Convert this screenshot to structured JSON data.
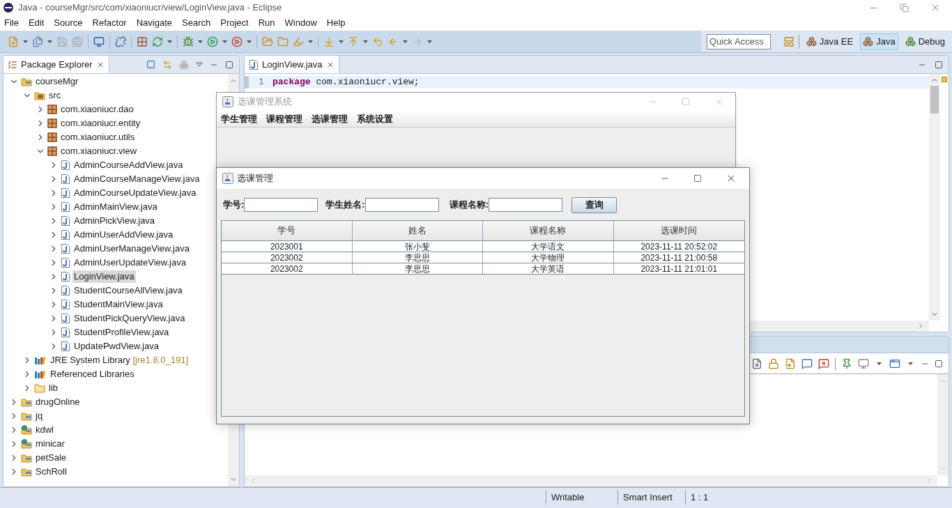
{
  "window": {
    "title": "Java - courseMgr/src/com/xiaoniucr/view/LoginView.java - Eclipse"
  },
  "menu": [
    "File",
    "Edit",
    "Source",
    "Refactor",
    "Navigate",
    "Search",
    "Project",
    "Run",
    "Window",
    "Help"
  ],
  "quick_access": {
    "placeholder": "Quick Access"
  },
  "perspectives": [
    {
      "label": "Java EE",
      "selected": false
    },
    {
      "label": "Java",
      "selected": true
    },
    {
      "label": "Debug",
      "selected": false
    }
  ],
  "package_explorer": {
    "title": "Package Explorer",
    "tree": [
      {
        "label": "courseMgr",
        "kind": "project",
        "expanded": true,
        "selected": false,
        "children": [
          {
            "label": "src",
            "kind": "source-folder",
            "expanded": true,
            "selected": false,
            "children": [
              {
                "label": "com.xiaoniucr.dao",
                "kind": "package",
                "expanded": false,
                "selected": false
              },
              {
                "label": "com.xiaoniucr.entity",
                "kind": "package",
                "expanded": false,
                "selected": false
              },
              {
                "label": "com.xiaoniucr.utils",
                "kind": "package",
                "expanded": false,
                "selected": false
              },
              {
                "label": "com.xiaoniucr.view",
                "kind": "package",
                "expanded": true,
                "selected": false,
                "children": [
                  {
                    "label": "AdminCourseAddView.java",
                    "kind": "java-file",
                    "expanded": false,
                    "selected": false
                  },
                  {
                    "label": "AdminCourseManageView.java",
                    "kind": "java-file",
                    "expanded": false,
                    "selected": false
                  },
                  {
                    "label": "AdminCourseUpdateView.java",
                    "kind": "java-file",
                    "expanded": false,
                    "selected": false
                  },
                  {
                    "label": "AdminMainView.java",
                    "kind": "java-file",
                    "expanded": false,
                    "selected": false
                  },
                  {
                    "label": "AdminPickView.java",
                    "kind": "java-file",
                    "expanded": false,
                    "selected": false
                  },
                  {
                    "label": "AdminUserAddView.java",
                    "kind": "java-file",
                    "expanded": false,
                    "selected": false
                  },
                  {
                    "label": "AdminUserManageView.java",
                    "kind": "java-file",
                    "expanded": false,
                    "selected": false
                  },
                  {
                    "label": "AdminUserUpdateView.java",
                    "kind": "java-file",
                    "expanded": false,
                    "selected": false
                  },
                  {
                    "label": "LoginView.java",
                    "kind": "java-file",
                    "expanded": false,
                    "selected": true
                  },
                  {
                    "label": "StudentCourseAllView.java",
                    "kind": "java-file",
                    "expanded": false,
                    "selected": false
                  },
                  {
                    "label": "StudentMainView.java",
                    "kind": "java-file",
                    "expanded": false,
                    "selected": false
                  },
                  {
                    "label": "StudentPickQueryView.java",
                    "kind": "java-file",
                    "expanded": false,
                    "selected": false
                  },
                  {
                    "label": "StudentProfileView.java",
                    "kind": "java-file",
                    "expanded": false,
                    "selected": false
                  },
                  {
                    "label": "UpdatePwdView.java",
                    "kind": "java-file",
                    "expanded": false,
                    "selected": false
                  }
                ]
              }
            ]
          },
          {
            "label": "JRE System Library",
            "suffix": "[jre1.8.0_191]",
            "kind": "library",
            "expanded": false,
            "selected": false
          },
          {
            "label": "Referenced Libraries",
            "kind": "library",
            "expanded": false,
            "selected": false
          },
          {
            "label": "lib",
            "kind": "folder",
            "expanded": false,
            "selected": false
          }
        ]
      },
      {
        "label": "drugOnline",
        "kind": "project",
        "expanded": false,
        "selected": false
      },
      {
        "label": "jq",
        "kind": "project",
        "expanded": false,
        "selected": false
      },
      {
        "label": "kdwl",
        "kind": "web-project",
        "expanded": false,
        "selected": false
      },
      {
        "label": "minicar",
        "kind": "web-project",
        "expanded": false,
        "selected": false
      },
      {
        "label": "petSale",
        "kind": "project",
        "expanded": false,
        "selected": false
      },
      {
        "label": "SchRoll",
        "kind": "project",
        "expanded": false,
        "selected": false
      }
    ]
  },
  "editor": {
    "tabs": [
      {
        "label": "LoginView.java",
        "selected": true
      }
    ],
    "lines": [
      {
        "number": "1",
        "keyword": "package",
        "text": "com.xiaoniucr.view;"
      }
    ]
  },
  "status_bar": [
    "Writable",
    "Smart Insert",
    "1 : 1"
  ],
  "main_frame": {
    "title": "选课管理系统",
    "menu": [
      "学生管理",
      "课程管理",
      "选课管理",
      "系统设置"
    ]
  },
  "dialog": {
    "title": "选课管理",
    "filters": [
      {
        "label": "学号:"
      },
      {
        "label": "学生姓名:"
      },
      {
        "label": "课程名称:"
      }
    ],
    "button": "查询",
    "table": {
      "columns": [
        "学号",
        "姓名",
        "课程名称",
        "选课时间"
      ],
      "rows": [
        [
          "2023001",
          "张小斐",
          "大学语文",
          "2023-11-11 20:52:02"
        ],
        [
          "2023002",
          "李思思",
          "大学物理",
          "2023-11-11 21:00:58"
        ],
        [
          "2023002",
          "李思思",
          "大学英语",
          "2023-11-11 21:01:01"
        ]
      ]
    }
  }
}
